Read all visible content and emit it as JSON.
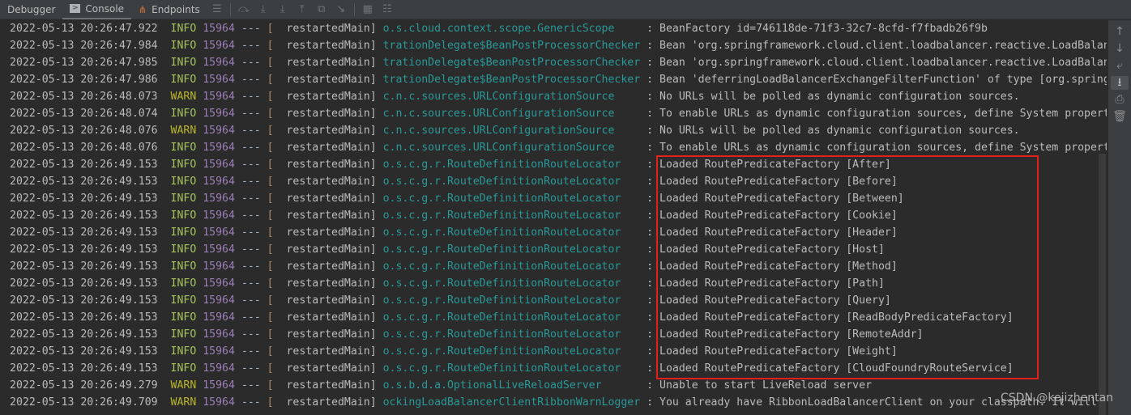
{
  "tabs": [
    {
      "label": "Debugger",
      "icon": "none"
    },
    {
      "label": "Console",
      "icon": "console-icon"
    },
    {
      "label": "Endpoints",
      "icon": "endpoints-icon"
    }
  ],
  "active_tab": "Console",
  "colors": {
    "background": "#2b2b2b",
    "info": "#a5c25c",
    "warn": "#bbb529",
    "pid": "#9c7fb8",
    "logger": "#299999",
    "highlight_box": "#e3211b"
  },
  "watermark": "CSDN @kejizhentan",
  "lines": [
    {
      "time": "2022-05-13 20:26:47.922",
      "level": "INFO",
      "pid": "15964",
      "thread": "restartedMain",
      "logger": "o.s.cloud.context.scope.GenericScope    ",
      "message": "BeanFactory id=746118de-71f3-32c7-8cfd-f7fbadb26f9b"
    },
    {
      "time": "2022-05-13 20:26:47.984",
      "level": "INFO",
      "pid": "15964",
      "thread": "restartedMain",
      "logger": "trationDelegate$BeanPostProcessorChecker",
      "message": "Bean 'org.springframework.cloud.client.loadbalancer.reactive.LoadBalancer"
    },
    {
      "time": "2022-05-13 20:26:47.985",
      "level": "INFO",
      "pid": "15964",
      "thread": "restartedMain",
      "logger": "trationDelegate$BeanPostProcessorChecker",
      "message": "Bean 'org.springframework.cloud.client.loadbalancer.reactive.LoadBalancer"
    },
    {
      "time": "2022-05-13 20:26:47.986",
      "level": "INFO",
      "pid": "15964",
      "thread": "restartedMain",
      "logger": "trationDelegate$BeanPostProcessorChecker",
      "message": "Bean 'deferringLoadBalancerExchangeFilterFunction' of type [org.springfr"
    },
    {
      "time": "2022-05-13 20:26:48.073",
      "level": "WARN",
      "pid": "15964",
      "thread": "restartedMain",
      "logger": "c.n.c.sources.URLConfigurationSource    ",
      "message": "No URLs will be polled as dynamic configuration sources."
    },
    {
      "time": "2022-05-13 20:26:48.074",
      "level": "INFO",
      "pid": "15964",
      "thread": "restartedMain",
      "logger": "c.n.c.sources.URLConfigurationSource    ",
      "message": "To enable URLs as dynamic configuration sources, define System properties"
    },
    {
      "time": "2022-05-13 20:26:48.076",
      "level": "WARN",
      "pid": "15964",
      "thread": "restartedMain",
      "logger": "c.n.c.sources.URLConfigurationSource    ",
      "message": "No URLs will be polled as dynamic configuration sources."
    },
    {
      "time": "2022-05-13 20:26:48.076",
      "level": "INFO",
      "pid": "15964",
      "thread": "restartedMain",
      "logger": "c.n.c.sources.URLConfigurationSource    ",
      "message": "To enable URLs as dynamic configuration sources, define System properties"
    },
    {
      "time": "2022-05-13 20:26:49.153",
      "level": "INFO",
      "pid": "15964",
      "thread": "restartedMain",
      "logger": "o.s.c.g.r.RouteDefinitionRouteLocator   ",
      "message": "Loaded RoutePredicateFactory [After]"
    },
    {
      "time": "2022-05-13 20:26:49.153",
      "level": "INFO",
      "pid": "15964",
      "thread": "restartedMain",
      "logger": "o.s.c.g.r.RouteDefinitionRouteLocator   ",
      "message": "Loaded RoutePredicateFactory [Before]"
    },
    {
      "time": "2022-05-13 20:26:49.153",
      "level": "INFO",
      "pid": "15964",
      "thread": "restartedMain",
      "logger": "o.s.c.g.r.RouteDefinitionRouteLocator   ",
      "message": "Loaded RoutePredicateFactory [Between]"
    },
    {
      "time": "2022-05-13 20:26:49.153",
      "level": "INFO",
      "pid": "15964",
      "thread": "restartedMain",
      "logger": "o.s.c.g.r.RouteDefinitionRouteLocator   ",
      "message": "Loaded RoutePredicateFactory [Cookie]"
    },
    {
      "time": "2022-05-13 20:26:49.153",
      "level": "INFO",
      "pid": "15964",
      "thread": "restartedMain",
      "logger": "o.s.c.g.r.RouteDefinitionRouteLocator   ",
      "message": "Loaded RoutePredicateFactory [Header]"
    },
    {
      "time": "2022-05-13 20:26:49.153",
      "level": "INFO",
      "pid": "15964",
      "thread": "restartedMain",
      "logger": "o.s.c.g.r.RouteDefinitionRouteLocator   ",
      "message": "Loaded RoutePredicateFactory [Host]"
    },
    {
      "time": "2022-05-13 20:26:49.153",
      "level": "INFO",
      "pid": "15964",
      "thread": "restartedMain",
      "logger": "o.s.c.g.r.RouteDefinitionRouteLocator   ",
      "message": "Loaded RoutePredicateFactory [Method]"
    },
    {
      "time": "2022-05-13 20:26:49.153",
      "level": "INFO",
      "pid": "15964",
      "thread": "restartedMain",
      "logger": "o.s.c.g.r.RouteDefinitionRouteLocator   ",
      "message": "Loaded RoutePredicateFactory [Path]"
    },
    {
      "time": "2022-05-13 20:26:49.153",
      "level": "INFO",
      "pid": "15964",
      "thread": "restartedMain",
      "logger": "o.s.c.g.r.RouteDefinitionRouteLocator   ",
      "message": "Loaded RoutePredicateFactory [Query]"
    },
    {
      "time": "2022-05-13 20:26:49.153",
      "level": "INFO",
      "pid": "15964",
      "thread": "restartedMain",
      "logger": "o.s.c.g.r.RouteDefinitionRouteLocator   ",
      "message": "Loaded RoutePredicateFactory [ReadBodyPredicateFactory]"
    },
    {
      "time": "2022-05-13 20:26:49.153",
      "level": "INFO",
      "pid": "15964",
      "thread": "restartedMain",
      "logger": "o.s.c.g.r.RouteDefinitionRouteLocator   ",
      "message": "Loaded RoutePredicateFactory [RemoteAddr]"
    },
    {
      "time": "2022-05-13 20:26:49.153",
      "level": "INFO",
      "pid": "15964",
      "thread": "restartedMain",
      "logger": "o.s.c.g.r.RouteDefinitionRouteLocator   ",
      "message": "Loaded RoutePredicateFactory [Weight]"
    },
    {
      "time": "2022-05-13 20:26:49.153",
      "level": "INFO",
      "pid": "15964",
      "thread": "restartedMain",
      "logger": "o.s.c.g.r.RouteDefinitionRouteLocator   ",
      "message": "Loaded RoutePredicateFactory [CloudFoundryRouteService]"
    },
    {
      "time": "2022-05-13 20:26:49.279",
      "level": "WARN",
      "pid": "15964",
      "thread": "restartedMain",
      "logger": "o.s.b.d.a.OptionalLiveReloadServer      ",
      "message": "Unable to start LiveReload server"
    },
    {
      "time": "2022-05-13 20:26:49.709",
      "level": "WARN",
      "pid": "15964",
      "thread": "restartedMain",
      "logger": "ockingLoadBalancerClientRibbonWarnLogger",
      "message": "You already have RibbonLoadBalancerClient on your classpath. It will"
    }
  ]
}
